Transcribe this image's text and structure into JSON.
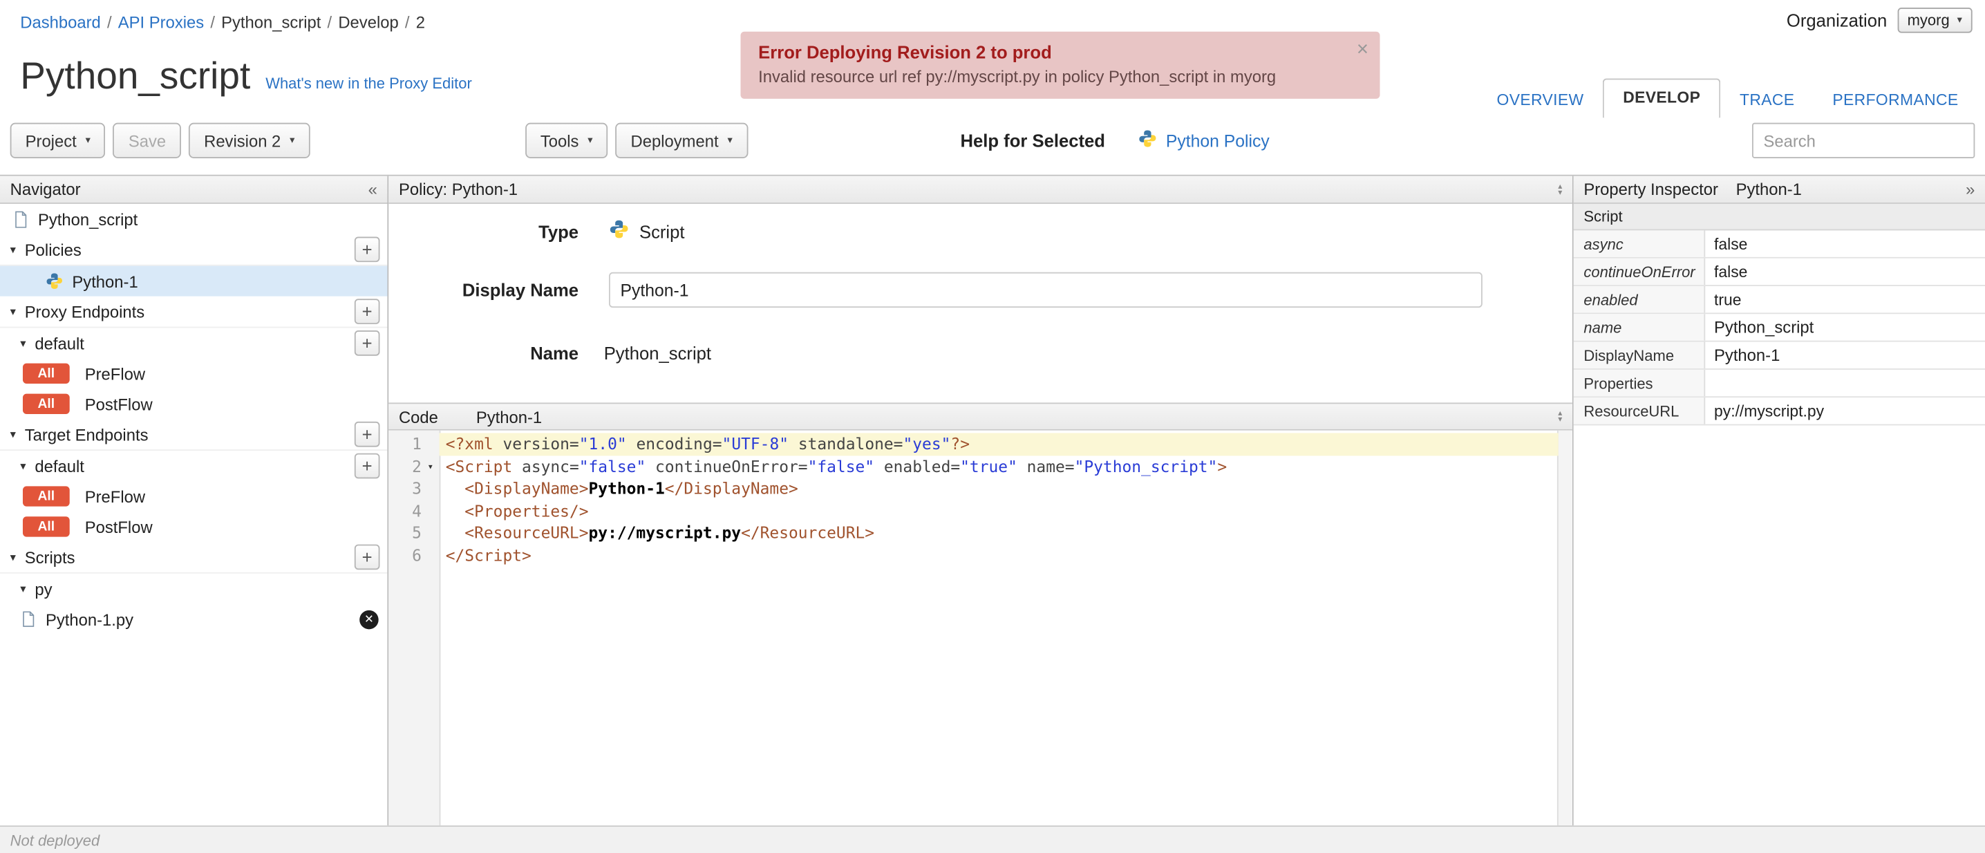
{
  "breadcrumb": {
    "separator": "/",
    "items": [
      {
        "label": "Dashboard"
      },
      {
        "label": "API Proxies"
      },
      {
        "label": "Python_script"
      },
      {
        "label": "Develop"
      },
      {
        "label": "2"
      }
    ]
  },
  "org": {
    "label": "Organization",
    "value": "myorg"
  },
  "icons": {
    "caret": "▾",
    "collapse_left": "«",
    "expand_right": "»",
    "plus": "+",
    "triangle_down": "▾",
    "triangle_up": "▴",
    "delete_x": "✕",
    "close": "×",
    "fold": "▾"
  },
  "error_banner": {
    "title": "Error Deploying Revision 2 to prod",
    "message": "Invalid resource url ref py://myscript.py in policy Python_script in myorg"
  },
  "header": {
    "title": "Python_script",
    "whats_new": "What's new in the Proxy Editor"
  },
  "tabs": [
    {
      "label": "OVERVIEW"
    },
    {
      "label": "DEVELOP"
    },
    {
      "label": "TRACE"
    },
    {
      "label": "PERFORMANCE"
    }
  ],
  "toolbar": {
    "project": "Project",
    "save": "Save",
    "revision": "Revision 2",
    "tools": "Tools",
    "deployment": "Deployment",
    "help_label": "Help for Selected",
    "help_link": "Python Policy",
    "search_placeholder": "Search"
  },
  "navigator": {
    "title": "Navigator",
    "rows": [
      {
        "label": "Python_script"
      },
      {
        "label": "Policies"
      },
      {
        "label": "Python-1"
      },
      {
        "label": "Proxy Endpoints"
      },
      {
        "label": "default"
      },
      {
        "label": "PreFlow",
        "badge": "All"
      },
      {
        "label": "PostFlow",
        "badge": "All"
      },
      {
        "label": "Target Endpoints"
      },
      {
        "label": "default"
      },
      {
        "label": "PreFlow",
        "badge": "All"
      },
      {
        "label": "PostFlow",
        "badge": "All"
      },
      {
        "label": "Scripts"
      },
      {
        "label": "py"
      },
      {
        "label": "Python-1.py"
      }
    ]
  },
  "policy": {
    "header": "Policy: Python-1",
    "type_label": "Type",
    "type_value": "Script",
    "display_name_label": "Display Name",
    "display_name_value": "Python-1",
    "name_label": "Name",
    "name_value": "Python_script"
  },
  "code": {
    "label": "Code",
    "file": "Python-1",
    "lines": [
      {
        "num": "1",
        "tokens": [
          {
            "v": "<?xml "
          },
          {
            "v": "version="
          },
          {
            "v": "\"1.0\""
          },
          {
            "v": " encoding="
          },
          {
            "v": "\"UTF-8\""
          },
          {
            "v": " standalone="
          },
          {
            "v": "\"yes\""
          },
          {
            "v": "?>"
          }
        ]
      },
      {
        "num": "2",
        "tokens": [
          {
            "v": "<Script "
          },
          {
            "v": "async="
          },
          {
            "v": "\"false\""
          },
          {
            "v": " continueOnError="
          },
          {
            "v": "\"false\""
          },
          {
            "v": " enabled="
          },
          {
            "v": "\"true\""
          },
          {
            "v": " name="
          },
          {
            "v": "\"Python_script\""
          },
          {
            "v": ">"
          }
        ]
      },
      {
        "num": "3",
        "tokens": [
          {
            "v": "  <DisplayName>"
          },
          {
            "v": "Python-1"
          },
          {
            "v": "</DisplayName>"
          }
        ]
      },
      {
        "num": "4",
        "tokens": [
          {
            "v": "  <Properties/>"
          }
        ]
      },
      {
        "num": "5",
        "tokens": [
          {
            "v": "  <ResourceURL>"
          },
          {
            "v": "py://myscript.py"
          },
          {
            "v": "</ResourceURL>"
          }
        ]
      },
      {
        "num": "6",
        "tokens": [
          {
            "v": "</Script>"
          }
        ]
      }
    ]
  },
  "inspector": {
    "title": "Property Inspector",
    "subtitle": "Python-1",
    "section": "Script",
    "rows": [
      {
        "key": "async",
        "value": "false"
      },
      {
        "key": "continueOnError",
        "value": "false"
      },
      {
        "key": "enabled",
        "value": "true"
      },
      {
        "key": "name",
        "value": "Python_script"
      },
      {
        "key": "DisplayName",
        "value": "Python-1"
      },
      {
        "key": "Properties",
        "value": ""
      },
      {
        "key": "ResourceURL",
        "value": "py://myscript.py"
      }
    ]
  },
  "status": {
    "text": "Not deployed"
  }
}
